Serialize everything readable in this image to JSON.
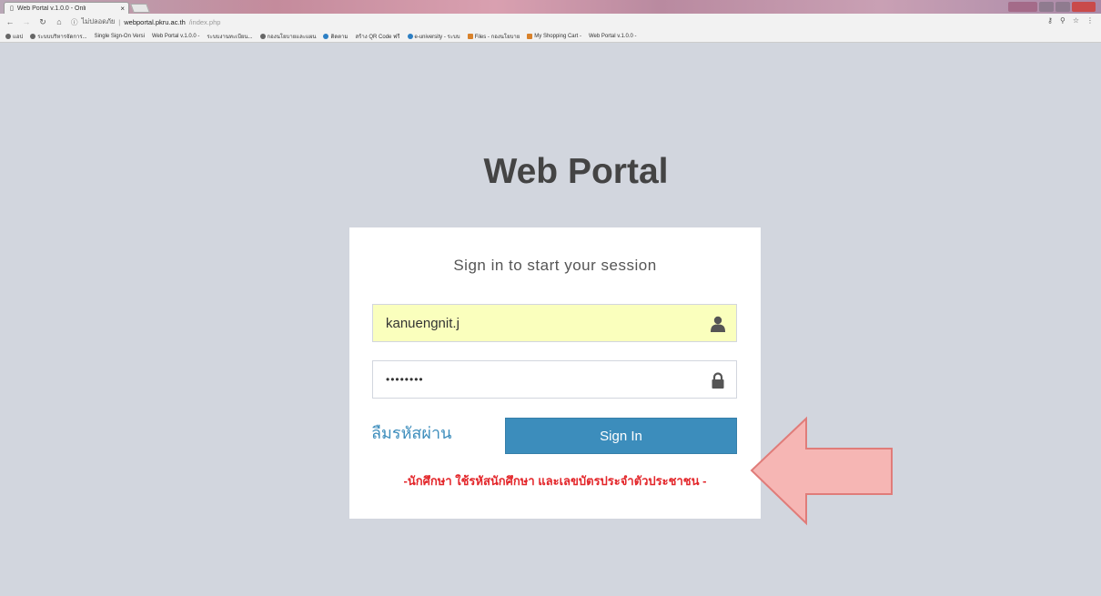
{
  "browser": {
    "tab_title": "Web Portal v.1.0.0 - Onli",
    "tab_close": "×",
    "address": {
      "security": "ไม่ปลอดภัย",
      "host": "webportal.pkru.ac.th",
      "path": "/index.php"
    },
    "bookmarks": [
      {
        "icon": "apps",
        "label": "แอป"
      },
      {
        "icon": "globe",
        "label": "ระบบบริหารจัดการ..."
      },
      {
        "icon": "page",
        "label": "Single Sign-On Versi"
      },
      {
        "icon": "page",
        "label": "Web Portal v.1.0.0 -"
      },
      {
        "icon": "page",
        "label": "ระบบงานทะเบียน..."
      },
      {
        "icon": "globe",
        "label": "กองนโยบายและแผน"
      },
      {
        "icon": "blue",
        "label": "ติดตาม"
      },
      {
        "icon": "page",
        "label": "สร้าง QR Code ฟรี"
      },
      {
        "icon": "blue",
        "label": "e-university - ระบบ"
      },
      {
        "icon": "orange",
        "label": "Files - กองนโยบาย"
      },
      {
        "icon": "orange",
        "label": "My Shopping Cart -"
      },
      {
        "icon": "page",
        "label": "Web Portal v.1.0.0 -"
      }
    ]
  },
  "page": {
    "logo": "Web Portal",
    "login_message": "Sign in to start your session",
    "username_value": "kanuengnit.j",
    "password_value": "••••••••",
    "forgot_password": "ลืมรหัสผ่าน",
    "signin_label": "Sign In",
    "note": "-นักศึกษา ใช้รหัสนักศึกษา และเลขบัตรประจำตัวประชาชน -"
  },
  "colors": {
    "page_bg": "#d2d6de",
    "primary": "#3c8dbc",
    "autofill": "#faffbd",
    "note": "#e3262a",
    "arrow_fill": "#f6b6b4",
    "arrow_stroke": "#e07c79"
  }
}
